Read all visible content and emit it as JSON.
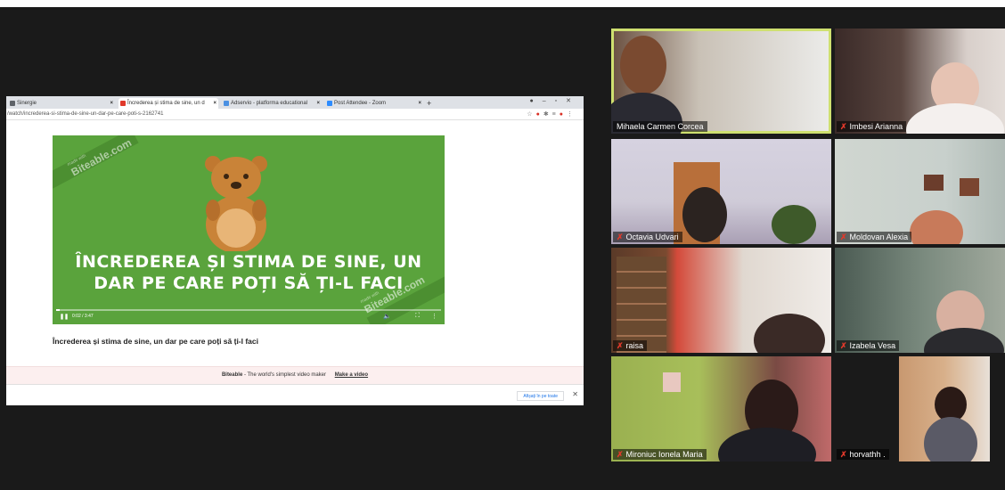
{
  "browser": {
    "tabs": [
      {
        "label": "Sinergie",
        "color": "#5f6368"
      },
      {
        "label": "Încrederea și stima de sine, un d",
        "color": "#e0392b",
        "active": true
      },
      {
        "label": "Adservio - platforma educational",
        "color": "#4a90e2"
      },
      {
        "label": "Post Attendee - Zoom",
        "color": "#2d8cff"
      }
    ],
    "new_tab": "+",
    "url": "/watch/increderea-si-stima-de-sine-un-dar-pe-care-poti-s-2162741"
  },
  "video": {
    "watermark": "Biteable.com",
    "watermark_small": "made with",
    "title_line1": "ÎNCREDEREA ȘI STIMA DE SINE, UN",
    "title_line2": "DAR PE CARE POȚI SĂ ȚI-L FACI",
    "time": "0:02 / 3:47",
    "progress_fraction": 0.01,
    "play_icon": "pause-icon"
  },
  "page": {
    "caption": "Încrederea și stima de sine, un dar pe care poți să ți-l faci",
    "footer_brand": "Biteable",
    "footer_text": " - The world's simplest video maker",
    "footer_link": "Make a video",
    "notif_button": "Afișați în pe toate"
  },
  "participants": [
    {
      "name": "Mihaela Carmen Corcea",
      "muted": false,
      "speaking": true
    },
    {
      "name": "Imbesi Arianna",
      "muted": true
    },
    {
      "name": "Octavia Udvari",
      "muted": true
    },
    {
      "name": "Moldovan Alexia",
      "muted": true
    },
    {
      "name": "raisa",
      "muted": true
    },
    {
      "name": "Izabela Vesa",
      "muted": true
    },
    {
      "name": "Mironiuc Ionela Maria",
      "muted": true
    },
    {
      "name": "horvathh .",
      "muted": true
    }
  ],
  "colors": {
    "stage": "#1a1a1a",
    "video_green": "#5aa33c",
    "active_speaker": "#cfe070",
    "muted_mic": "#e0392b"
  }
}
